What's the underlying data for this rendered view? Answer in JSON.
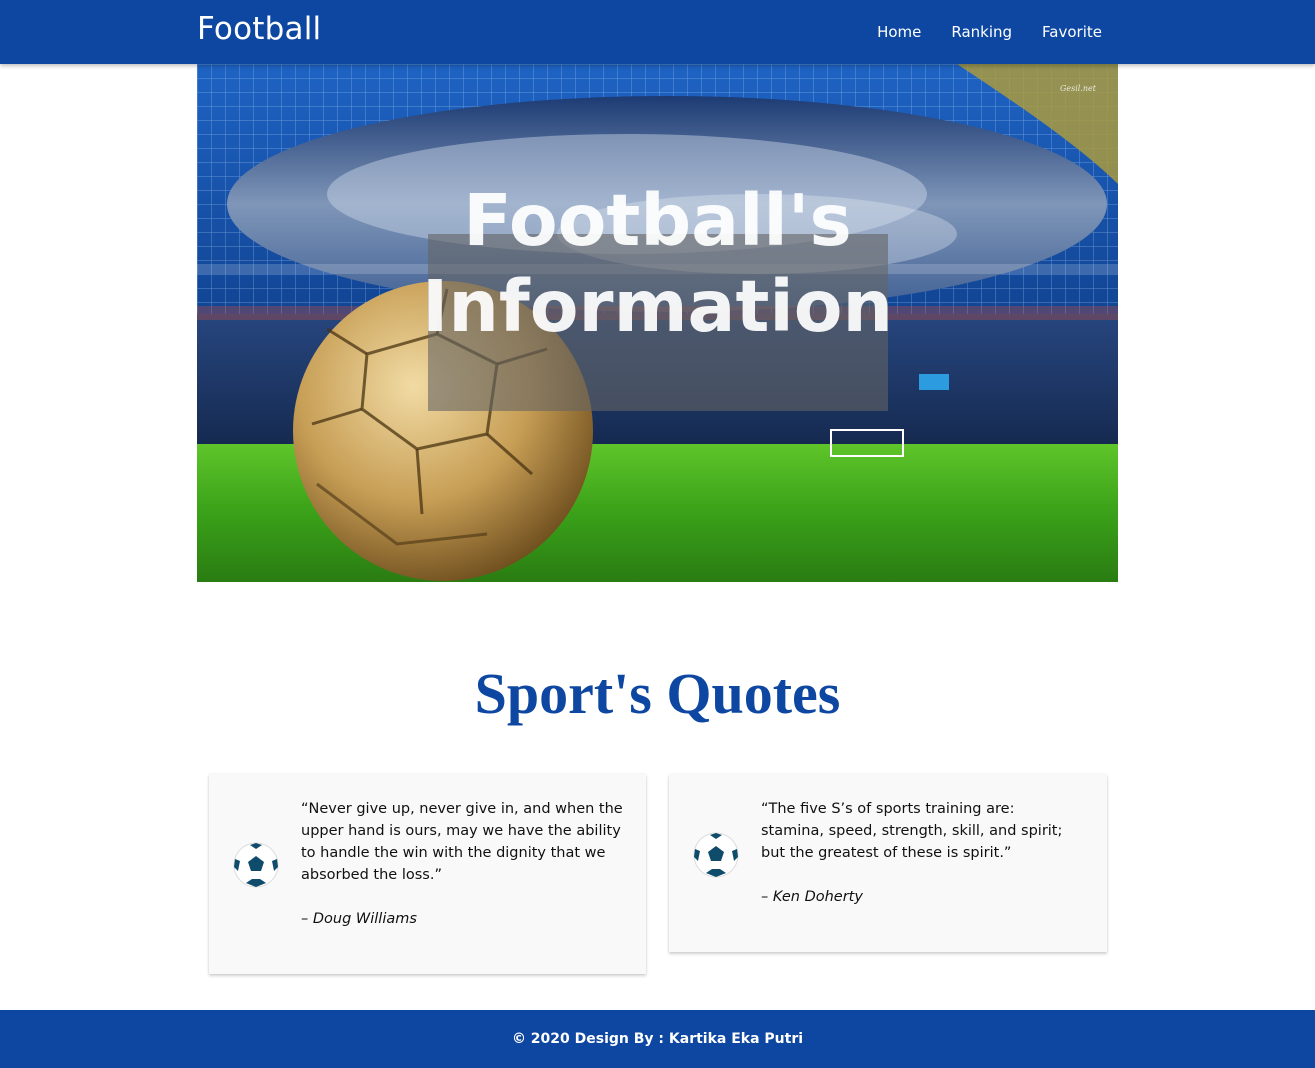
{
  "navbar": {
    "brand": "Football",
    "links": [
      {
        "label": "Home"
      },
      {
        "label": "Ranking"
      },
      {
        "label": "Favorite"
      }
    ],
    "color": "#0d47a1"
  },
  "hero": {
    "title_line1": "Football's",
    "title_line2": "Information",
    "watermark": "Gesil.net"
  },
  "quotes": {
    "title": "Sport's Quotes",
    "items": [
      {
        "text": "“Never give up, never give in, and when the upper hand is ours, may we have the ability to handle the win with the dignity that we absorbed the loss.”",
        "author": "– Doug Williams",
        "icon": "soccer-ball-icon"
      },
      {
        "text": "“The five S’s of sports training are: stamina, speed, strength, skill, and spirit; but the greatest of these is spirit.”",
        "author": "– Ken Doherty",
        "icon": "soccer-ball-icon"
      }
    ]
  },
  "footer": {
    "text": "© 2020 Design By : Kartika Eka Putri"
  }
}
